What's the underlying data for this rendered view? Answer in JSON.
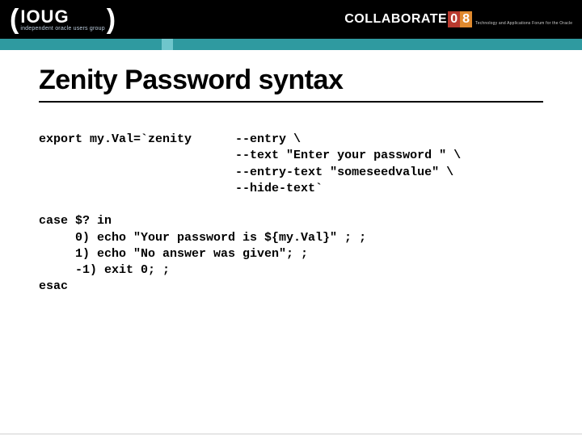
{
  "header": {
    "ioug_main": "IOUG",
    "ioug_sub": "independent oracle users group",
    "collab_word": "COLLABORATE",
    "collab_d0": "0",
    "collab_d1": "8",
    "collab_tag": "Technology and Applications Forum for the Oracle Community"
  },
  "title": "Zenity Password syntax",
  "code_block1_col1": "export my.Val=`zenity",
  "code_block1_col2_l1": "--entry \\",
  "code_block1_col2_l2": "--text \"Enter your password \" \\",
  "code_block1_col2_l3": "--entry-text \"someseedvalue\" \\",
  "code_block1_col2_l4": "--hide-text`",
  "code_block2_l1": "case $? in",
  "code_block2_l2": "     0) echo \"Your password is ${my.Val}\" ; ;",
  "code_block2_l3": "     1) echo \"No answer was given\"; ;",
  "code_block2_l4": "     -1) exit 0; ;",
  "code_block2_l5": "esac"
}
